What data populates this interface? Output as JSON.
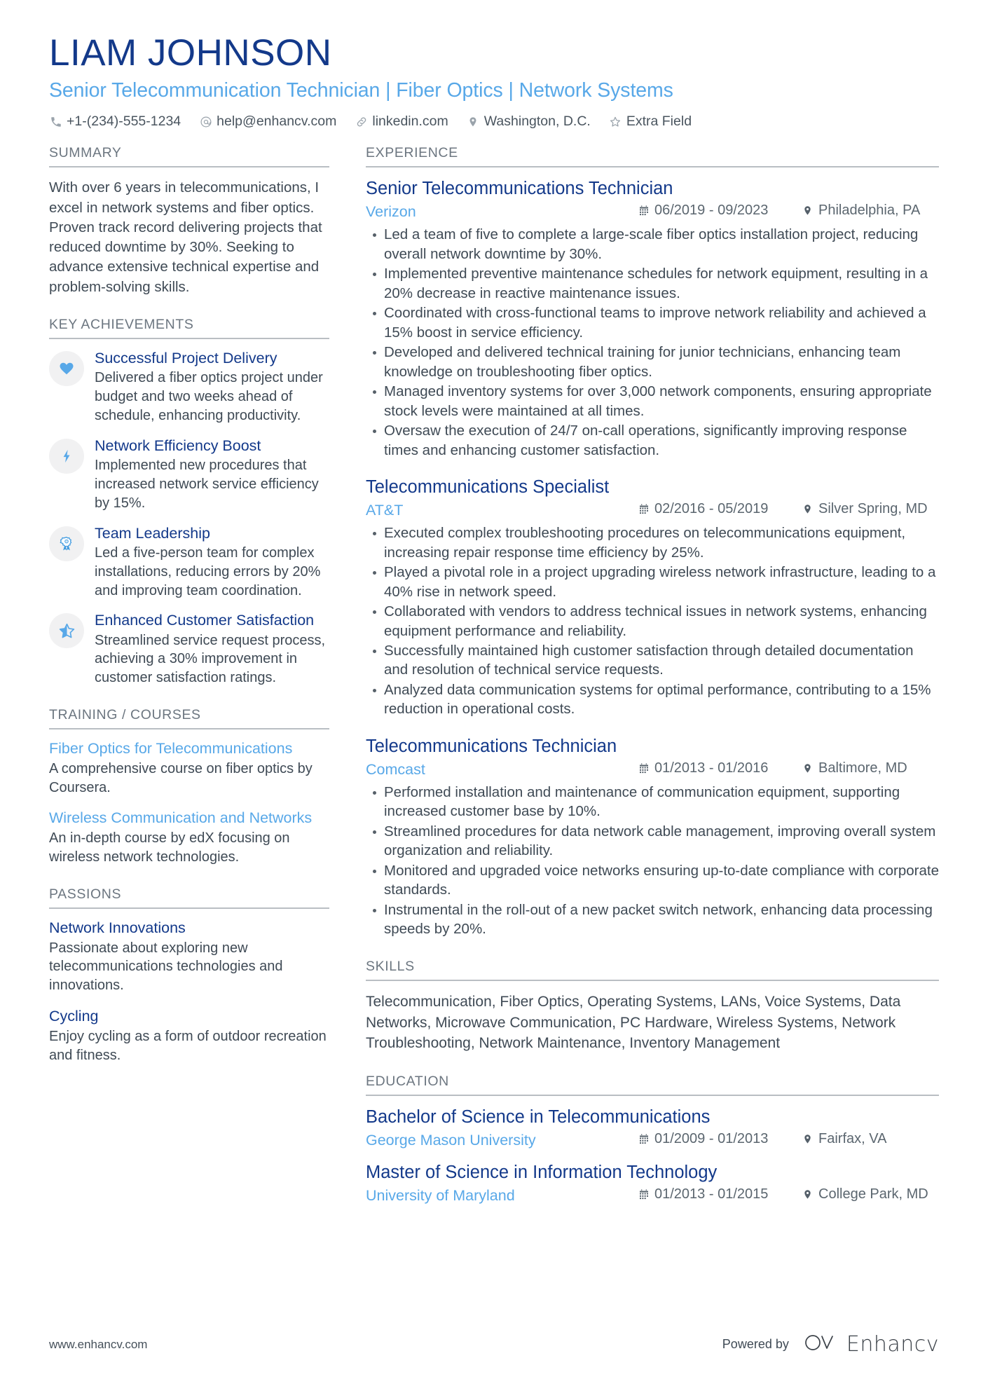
{
  "header": {
    "name": "LIAM JOHNSON",
    "title": "Senior Telecommunication Technician | Fiber Optics | Network Systems",
    "contacts": [
      {
        "icon": "phone-icon",
        "text": "+1-(234)-555-1234"
      },
      {
        "icon": "email-icon",
        "text": "help@enhancv.com"
      },
      {
        "icon": "link-icon",
        "text": "linkedin.com"
      },
      {
        "icon": "location-pin-icon",
        "text": "Washington, D.C."
      },
      {
        "icon": "star-icon",
        "text": "Extra Field"
      }
    ]
  },
  "sidebar": {
    "summary": {
      "heading": "SUMMARY",
      "text": "With over 6 years in telecommunications, I excel in network systems and fiber optics. Proven track record delivering projects that reduced downtime by 30%. Seeking to advance extensive technical expertise and problem-solving skills."
    },
    "key_achievements": {
      "heading": "KEY ACHIEVEMENTS",
      "items": [
        {
          "icon": "heart-icon",
          "title": "Successful Project Delivery",
          "description": "Delivered a fiber optics project under budget and two weeks ahead of schedule, enhancing productivity."
        },
        {
          "icon": "lightning-bolt-icon",
          "title": "Network Efficiency Boost",
          "description": "Implemented new procedures that increased network service efficiency by 15%."
        },
        {
          "icon": "award-ribbon-icon",
          "title": "Team Leadership",
          "description": "Led a five-person team for complex installations, reducing errors by 20% and improving team coordination."
        },
        {
          "icon": "half-star-icon",
          "title": "Enhanced Customer Satisfaction",
          "description": "Streamlined service request process, achieving a 30% improvement in customer satisfaction ratings."
        }
      ]
    },
    "training": {
      "heading": "TRAINING / COURSES",
      "items": [
        {
          "title": "Fiber Optics for Telecommunications",
          "description": "A comprehensive course on fiber optics by Coursera."
        },
        {
          "title": "Wireless Communication and Networks",
          "description": "An in-depth course by edX focusing on wireless network technologies."
        }
      ]
    },
    "passions": {
      "heading": "PASSIONS",
      "items": [
        {
          "title": "Network Innovations",
          "description": "Passionate about exploring new telecommunications technologies and innovations."
        },
        {
          "title": "Cycling",
          "description": "Enjoy cycling as a form of outdoor recreation and fitness."
        }
      ]
    }
  },
  "main": {
    "experience": {
      "heading": "EXPERIENCE",
      "jobs": [
        {
          "role": "Senior Telecommunications Technician",
          "company": "Verizon",
          "dates": "06/2019 - 09/2023",
          "location": "Philadelphia, PA",
          "bullets": [
            "Led a team of five to complete a large-scale fiber optics installation project, reducing overall network downtime by 30%.",
            "Implemented preventive maintenance schedules for network equipment, resulting in a 20% decrease in reactive maintenance issues.",
            "Coordinated with cross-functional teams to improve network reliability and achieved a 15% boost in service efficiency.",
            "Developed and delivered technical training for junior technicians, enhancing team knowledge on troubleshooting fiber optics.",
            "Managed inventory systems for over 3,000 network components, ensuring appropriate stock levels were maintained at all times.",
            "Oversaw the execution of 24/7 on-call operations, significantly improving response times and enhancing customer satisfaction."
          ]
        },
        {
          "role": "Telecommunications Specialist",
          "company": "AT&T",
          "dates": "02/2016 - 05/2019",
          "location": "Silver Spring, MD",
          "bullets": [
            "Executed complex troubleshooting procedures on telecommunications equipment, increasing repair response time efficiency by 25%.",
            "Played a pivotal role in a project upgrading wireless network infrastructure, leading to a 40% rise in network speed.",
            "Collaborated with vendors to address technical issues in network systems, enhancing equipment performance and reliability.",
            "Successfully maintained high customer satisfaction through detailed documentation and resolution of technical service requests.",
            "Analyzed data communication systems for optimal performance, contributing to a 15% reduction in operational costs."
          ]
        },
        {
          "role": "Telecommunications Technician",
          "company": "Comcast",
          "dates": "01/2013 - 01/2016",
          "location": "Baltimore, MD",
          "bullets": [
            "Performed installation and maintenance of communication equipment, supporting increased customer base by 10%.",
            "Streamlined procedures for data network cable management, improving overall system organization and reliability.",
            "Monitored and upgraded voice networks ensuring up-to-date compliance with corporate standards.",
            "Instrumental in the roll-out of a new packet switch network, enhancing data processing speeds by 20%."
          ]
        }
      ]
    },
    "skills": {
      "heading": "SKILLS",
      "text": "Telecommunication, Fiber Optics, Operating Systems, LANs, Voice Systems, Data Networks, Microwave Communication, PC Hardware, Wireless Systems, Network Troubleshooting, Network Maintenance, Inventory Management"
    },
    "education": {
      "heading": "EDUCATION",
      "items": [
        {
          "degree": "Bachelor of Science in Telecommunications",
          "school": "George Mason University",
          "dates": "01/2009 - 01/2013",
          "location": "Fairfax, VA"
        },
        {
          "degree": "Master of Science in Information Technology",
          "school": "University of Maryland",
          "dates": "01/2013 - 01/2015",
          "location": "College Park, MD"
        }
      ]
    }
  },
  "footer": {
    "url": "www.enhancv.com",
    "powered_by": "Powered by",
    "brand": "Enhancv"
  },
  "colors": {
    "name_navy": "#13398a",
    "accent_blue": "#58a8e8",
    "body_gray": "#3f4a55",
    "heading_gray": "#6c7680",
    "rule_gray": "#b9bec3",
    "icon_circle": "#f1f1f2"
  }
}
